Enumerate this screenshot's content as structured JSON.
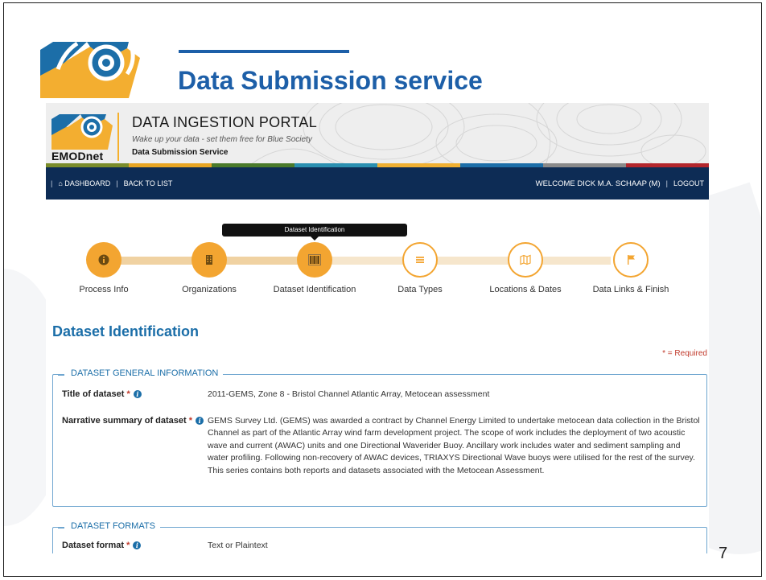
{
  "slide": {
    "title": "Data Submission service",
    "page_number": "7"
  },
  "portal": {
    "name": "DATA INGESTION PORTAL",
    "tagline": "Wake up your data - set them free for Blue Society",
    "service": "Data Submission Service",
    "logo_text": "EMODnet",
    "stripe_colors": [
      "#7a8c2a",
      "#e7a523",
      "#4a7a2a",
      "#2a8fb0",
      "#f0b032",
      "#1c6ea8",
      "#8a8a8a",
      "#b3262c"
    ]
  },
  "nav": {
    "dashboard": "DASHBOARD",
    "back_to_list": "BACK TO LIST",
    "welcome": "WELCOME DICK M.A. SCHAAP (M)",
    "logout": "LOGOUT"
  },
  "wizard": {
    "tooltip": "Dataset Identification",
    "steps": [
      {
        "label": "Process Info",
        "icon": "info-icon",
        "state": "done"
      },
      {
        "label": "Organizations",
        "icon": "building-icon",
        "state": "done"
      },
      {
        "label": "Dataset Identification",
        "icon": "barcode-icon",
        "state": "current"
      },
      {
        "label": "Data Types",
        "icon": "list-icon",
        "state": "todo"
      },
      {
        "label": "Locations & Dates",
        "icon": "map-icon",
        "state": "todo"
      },
      {
        "label": "Data Links & Finish",
        "icon": "flag-icon",
        "state": "todo"
      }
    ]
  },
  "form": {
    "heading": "Dataset Identification",
    "required_note": "* = Required",
    "general": {
      "legend": "DATASET GENERAL INFORMATION",
      "title_label": "Title of dataset",
      "title_value": "2011-GEMS, Zone 8 - Bristol Channel Atlantic Array, Metocean assessment",
      "summary_label": "Narrative summary of dataset",
      "summary_value": "GEMS Survey Ltd. (GEMS) was awarded a contract by Channel Energy Limited to undertake metocean data collection in the Bristol Channel as part of the Atlantic Array wind farm development project. The scope of work includes the deployment of two acoustic wave and current (AWAC) units and one Directional Waverider Buoy. Ancillary work includes water and sediment sampling and water profiling. Following non-recovery of AWAC devices, TRIAXYS Directional Wave buoys were utilised for the rest of the survey. This series contains both reports and datasets associated with the Metocean Assessment."
    },
    "formats": {
      "legend": "DATASET FORMATS",
      "format_label": "Dataset format",
      "format_value": "Text or Plaintext"
    }
  },
  "colors": {
    "accent_blue": "#1d5fa8",
    "nav_bg": "#0d2c55",
    "step_orange": "#f3a531",
    "required_red": "#c0392b"
  }
}
